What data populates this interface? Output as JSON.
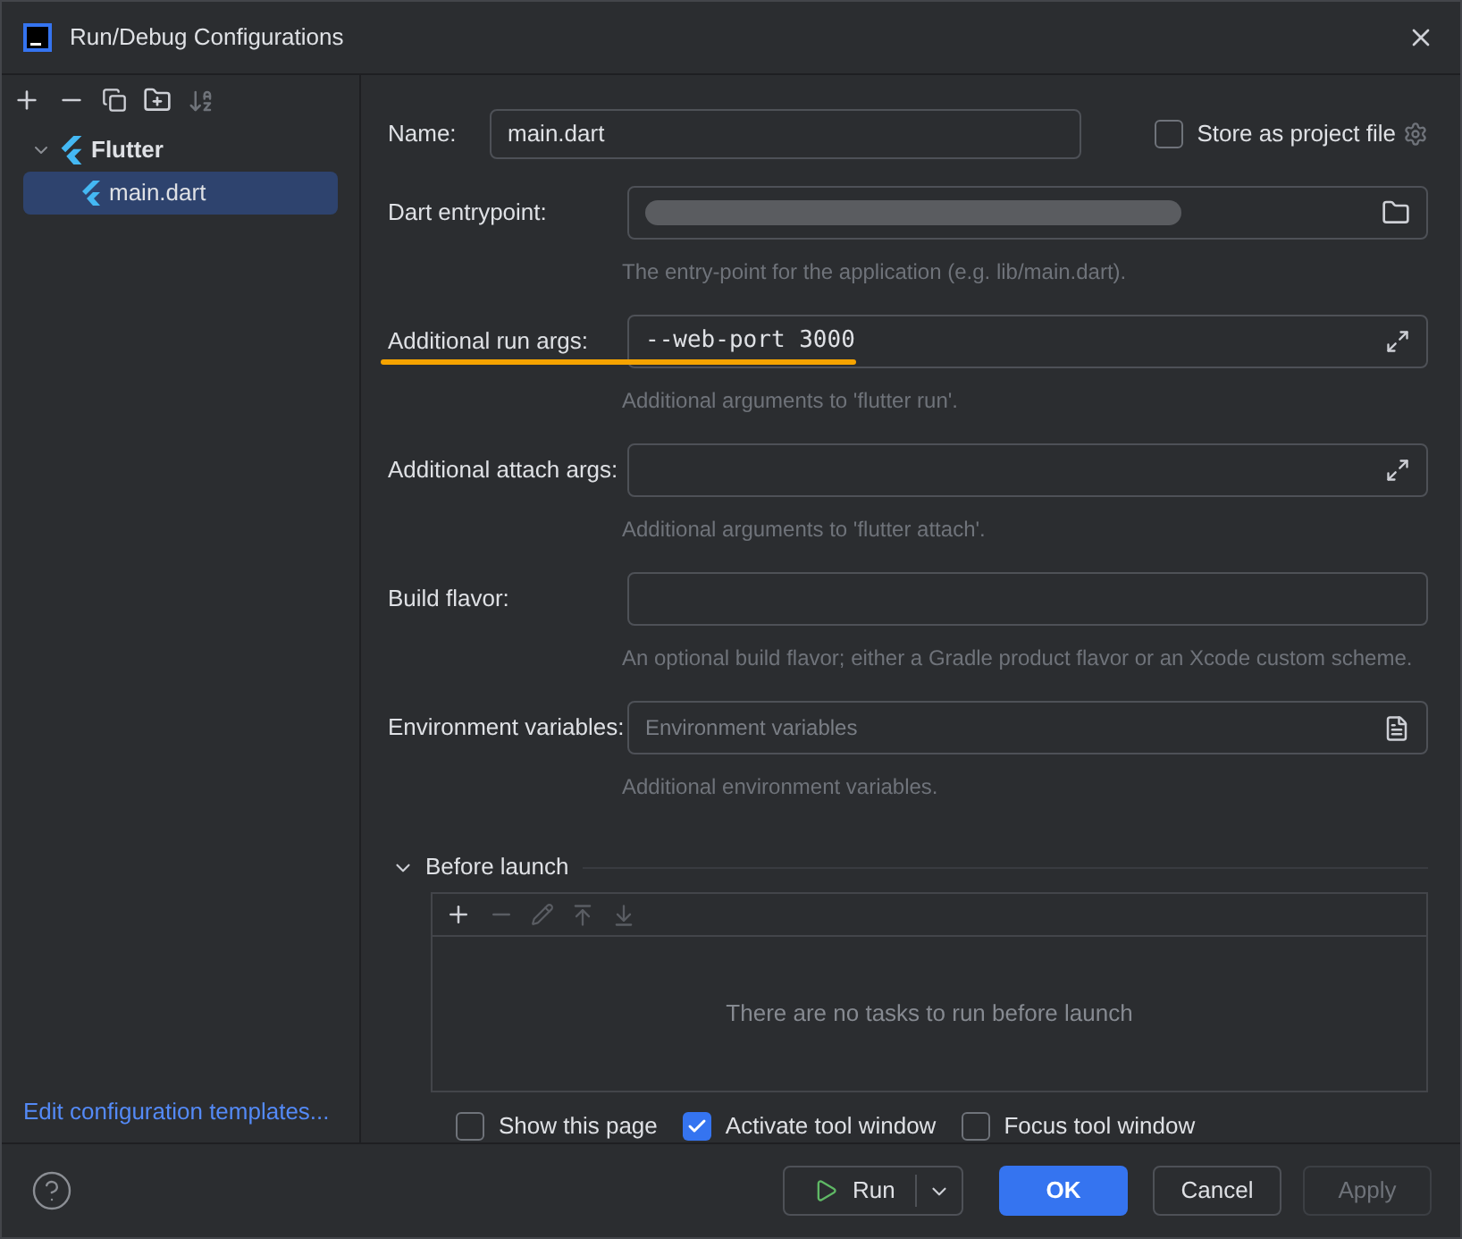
{
  "window": {
    "title": "Run/Debug Configurations"
  },
  "tree": [
    {
      "label": "Flutter",
      "expanded": true,
      "selected": false,
      "children": [
        {
          "label": "main.dart",
          "selected": true
        }
      ]
    }
  ],
  "templates_link": "Edit configuration templates...",
  "name_field": {
    "label": "Name:",
    "value": "main.dart"
  },
  "store_as_project_file": {
    "label": "Store as project file",
    "checked": false
  },
  "fields": [
    {
      "label": "Dart entrypoint:",
      "kind": "browse",
      "redacted": true,
      "highlighted": false,
      "hint": "The entry-point for the application (e.g. lib/main.dart)."
    },
    {
      "label": "Additional run args:",
      "kind": "expand",
      "value": "--web-port 3000",
      "redacted": false,
      "highlighted": true,
      "hint": "Additional arguments to 'flutter run'."
    },
    {
      "label": "Additional attach args:",
      "kind": "expand",
      "redacted": false,
      "highlighted": false,
      "hint": "Additional arguments to 'flutter attach'."
    },
    {
      "label": "Build flavor:",
      "kind": "plain",
      "redacted": false,
      "highlighted": false,
      "hint": "An optional build flavor; either a Gradle product flavor or an Xcode custom scheme."
    },
    {
      "label": "Environment variables:",
      "kind": "env",
      "placeholder": "Environment variables",
      "redacted": false,
      "highlighted": false,
      "hint": "Additional environment variables."
    }
  ],
  "before_launch": {
    "label": "Before launch",
    "expanded": true,
    "empty_text": "There are no tasks to run before launch"
  },
  "options": [
    {
      "label": "Show this page",
      "checked": false
    },
    {
      "label": "Activate tool window",
      "checked": true
    },
    {
      "label": "Focus tool window",
      "checked": false
    }
  ],
  "buttons": [
    {
      "label": "Run",
      "kind": "split"
    },
    {
      "label": "OK",
      "kind": "primary"
    },
    {
      "label": "Cancel",
      "kind": "default"
    },
    {
      "label": "Apply",
      "kind": "disabled"
    }
  ]
}
